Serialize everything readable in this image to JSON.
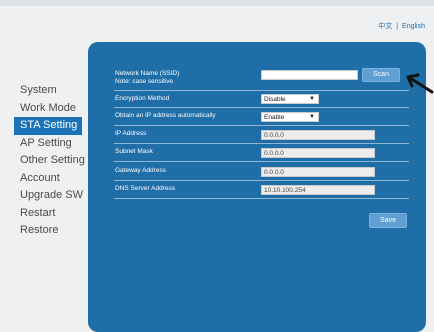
{
  "language": {
    "zh": "中文",
    "separator": "|",
    "en": "English"
  },
  "sidebar": {
    "items": [
      {
        "label": "System",
        "active": false
      },
      {
        "label": "Work Mode",
        "active": false
      },
      {
        "label": "STA Setting",
        "active": true
      },
      {
        "label": "AP Setting",
        "active": false
      },
      {
        "label": "Other Setting",
        "active": false
      },
      {
        "label": "Account",
        "active": false
      },
      {
        "label": "Upgrade SW",
        "active": false
      },
      {
        "label": "Restart",
        "active": false
      },
      {
        "label": "Restore",
        "active": false
      }
    ]
  },
  "form": {
    "ssid_label": "Network Name (SSID)",
    "ssid_note": "Note: case sensitive",
    "ssid_value": "",
    "scan_label": "Scan",
    "encryption_label": "Encryption Method",
    "encryption_value": "Disable",
    "dhcp_label": "Obtain an IP address automatically",
    "dhcp_value": "Enable",
    "ip_label": "IP Address",
    "ip_value": "0.0.0.0",
    "subnet_label": "Subnet Mask",
    "subnet_value": "0.0.0.0",
    "gateway_label": "Gateway Address",
    "gateway_value": "0.0.0.0",
    "dns_label": "DNS Server Address",
    "dns_value": "10.10.100.254",
    "save_label": "Save"
  },
  "colors": {
    "panel": "#1f6ea8",
    "active_nav": "#1a73b8",
    "button": "#5f9fd3"
  }
}
